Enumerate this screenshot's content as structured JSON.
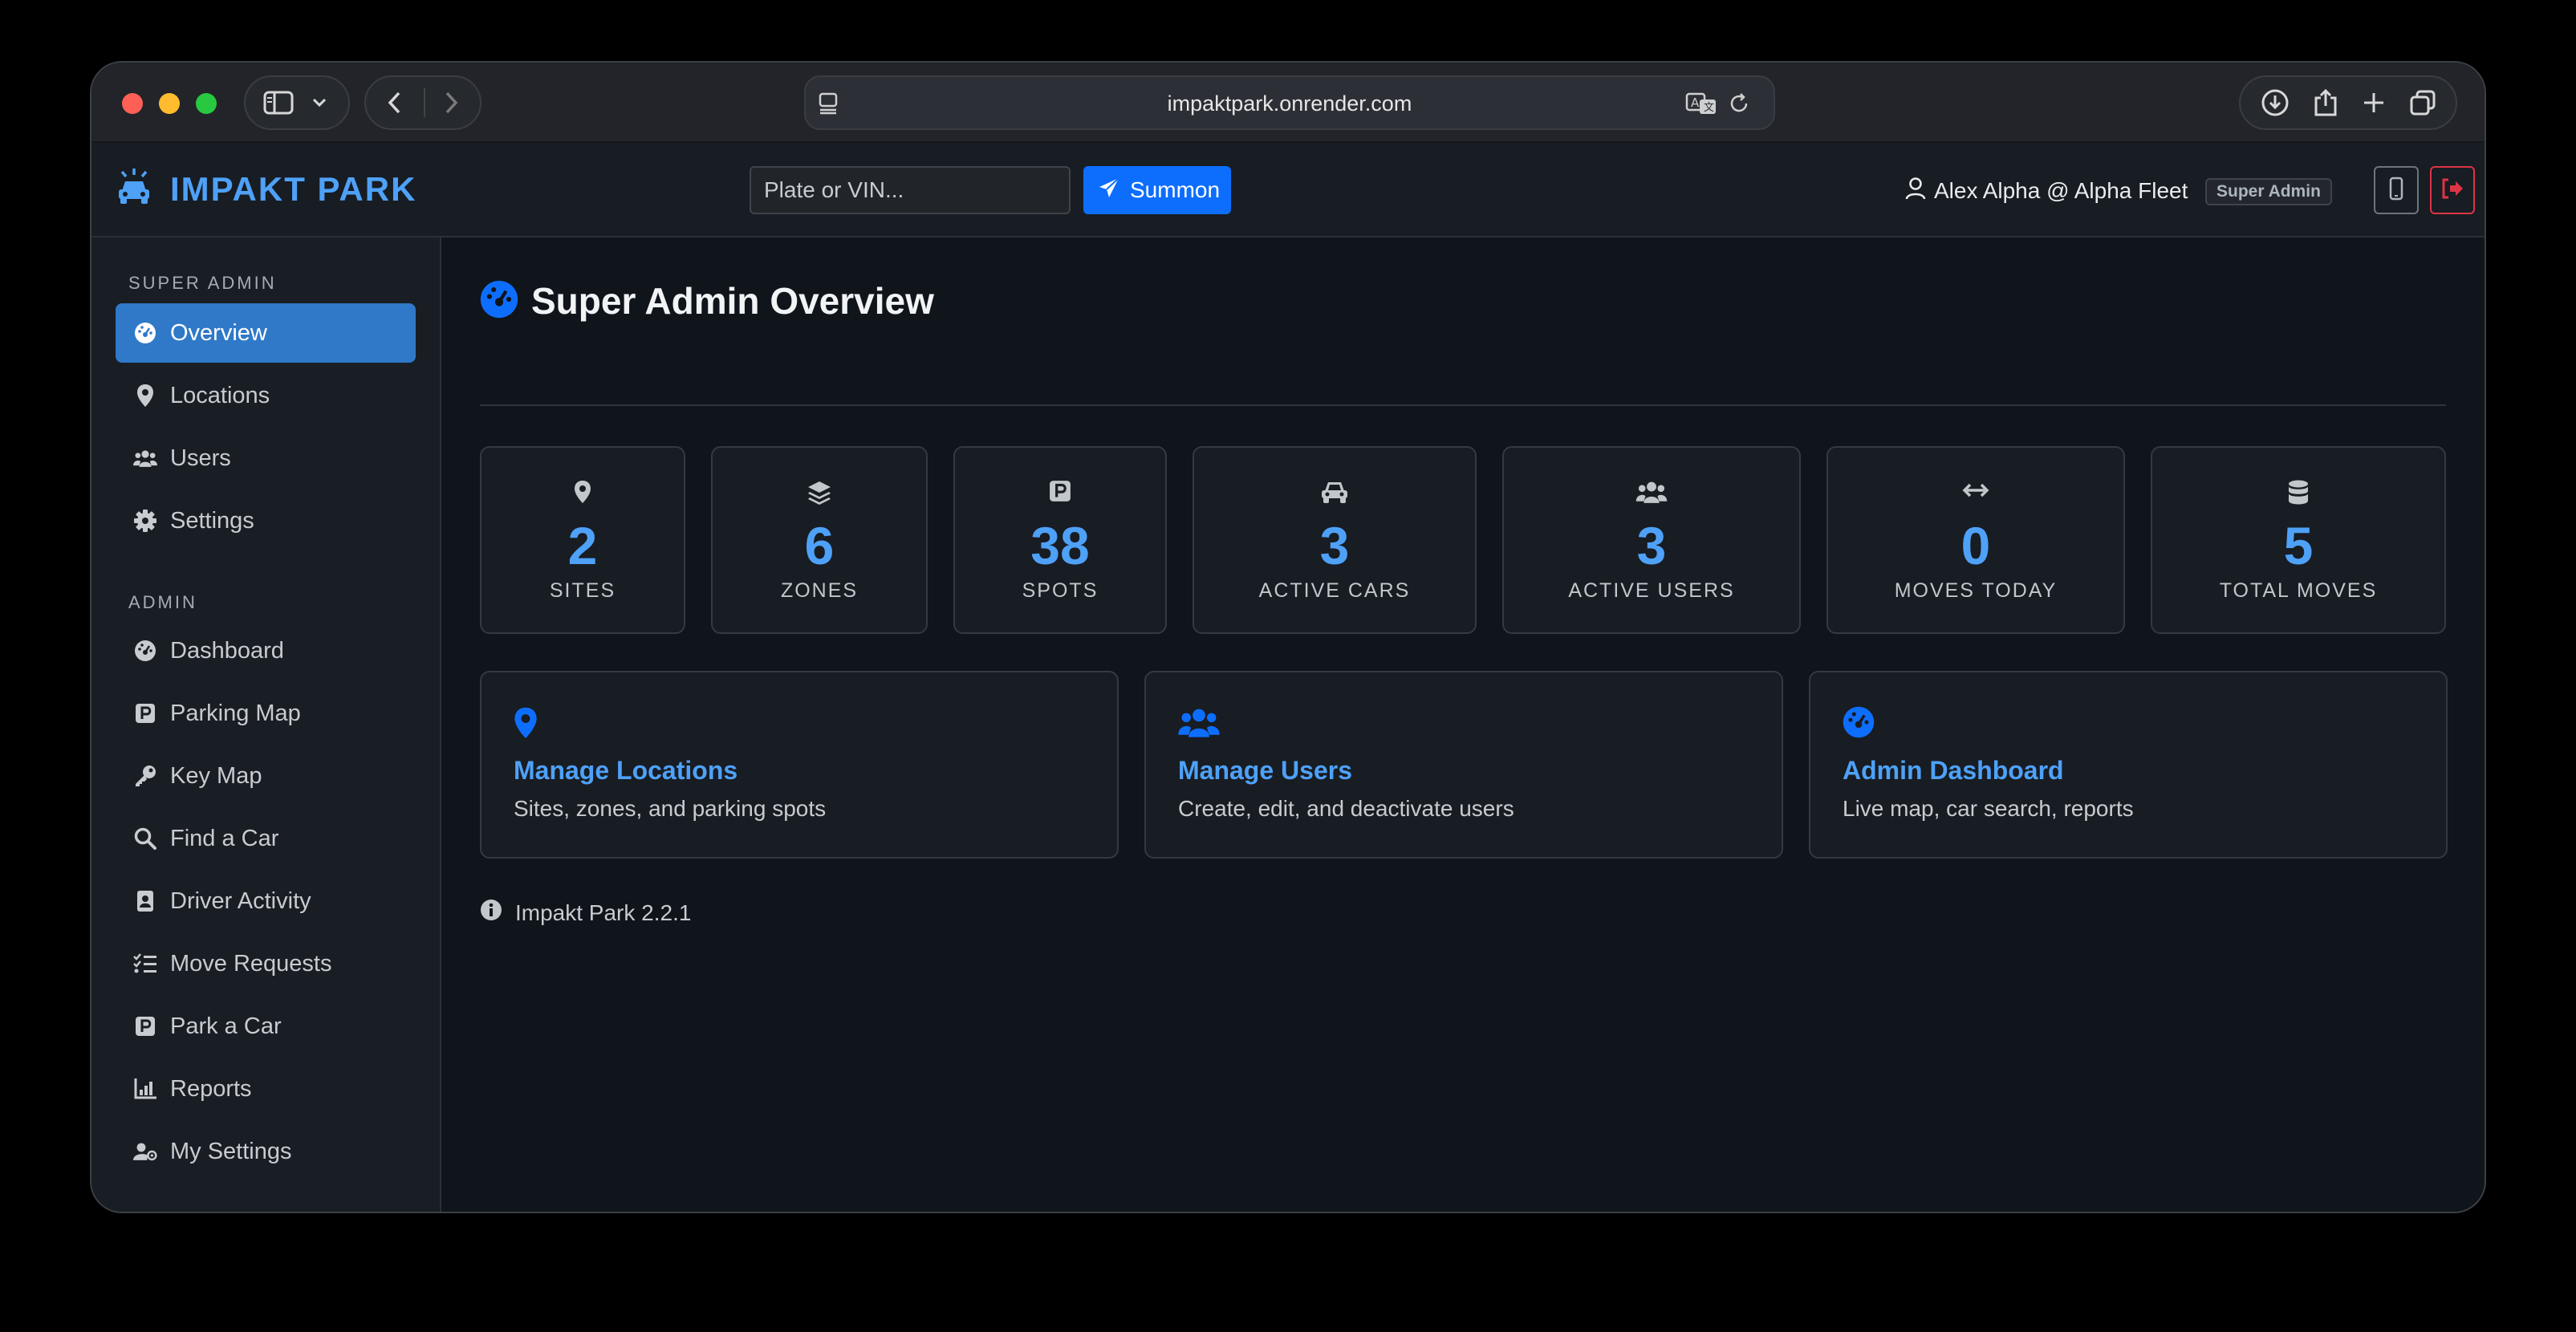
{
  "browser": {
    "url": "impaktpark.onrender.com"
  },
  "header": {
    "brand": "IMPAKT PARK",
    "search_placeholder": "Plate or VIN...",
    "summon_label": "Summon",
    "user_label": "Alex Alpha @ Alpha Fleet",
    "role_badge": "Super Admin"
  },
  "sidebar": {
    "sections": [
      {
        "title": "SUPER ADMIN",
        "items": [
          {
            "label": "Overview",
            "icon": "gauge-icon",
            "active": true
          },
          {
            "label": "Locations",
            "icon": "map-pin-icon"
          },
          {
            "label": "Users",
            "icon": "users-icon"
          },
          {
            "label": "Settings",
            "icon": "gear-icon"
          }
        ]
      },
      {
        "title": "ADMIN",
        "items": [
          {
            "label": "Dashboard",
            "icon": "gauge-icon"
          },
          {
            "label": "Parking Map",
            "icon": "parking-icon"
          },
          {
            "label": "Key Map",
            "icon": "key-icon"
          },
          {
            "label": "Find a Car",
            "icon": "search-icon"
          },
          {
            "label": "Driver Activity",
            "icon": "id-card-icon"
          },
          {
            "label": "Move Requests",
            "icon": "list-check-icon"
          },
          {
            "label": "Park a Car",
            "icon": "parking-icon"
          },
          {
            "label": "Reports",
            "icon": "bar-chart-icon"
          },
          {
            "label": "My Settings",
            "icon": "user-gear-icon"
          }
        ]
      }
    ]
  },
  "main": {
    "title": "Super Admin Overview",
    "stats": [
      {
        "value": "2",
        "label": "SITES",
        "icon": "map-pin-icon"
      },
      {
        "value": "6",
        "label": "ZONES",
        "icon": "layers-icon"
      },
      {
        "value": "38",
        "label": "SPOTS",
        "icon": "parking-icon"
      },
      {
        "value": "3",
        "label": "ACTIVE CARS",
        "icon": "car-icon"
      },
      {
        "value": "3",
        "label": "ACTIVE USERS",
        "icon": "users-icon"
      },
      {
        "value": "0",
        "label": "MOVES TODAY",
        "icon": "arrows-horizontal-icon"
      },
      {
        "value": "5",
        "label": "TOTAL MOVES",
        "icon": "database-icon"
      }
    ],
    "cards": [
      {
        "title": "Manage Locations",
        "desc": "Sites, zones, and parking spots",
        "icon": "map-pin-icon"
      },
      {
        "title": "Manage Users",
        "desc": "Create, edit, and deactivate users",
        "icon": "users-icon"
      },
      {
        "title": "Admin Dashboard",
        "desc": "Live map, car search, reports",
        "icon": "gauge-icon"
      }
    ],
    "version": "Impakt Park 2.2.1"
  },
  "colors": {
    "accent": "#4ea1f7",
    "primary_button": "#0d6efd",
    "active_nav": "#2f79c8",
    "danger": "#dc3545"
  }
}
